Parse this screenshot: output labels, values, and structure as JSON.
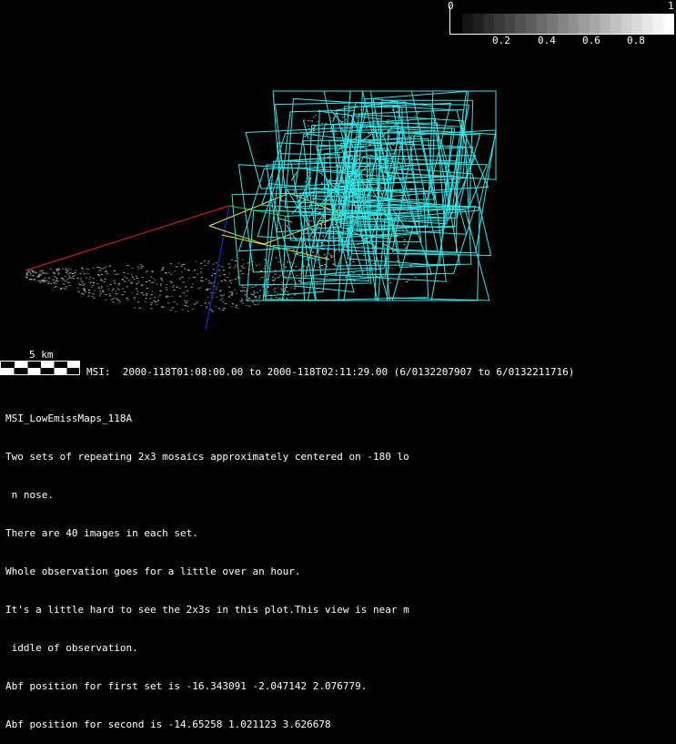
{
  "colorbar": {
    "min_label": "0",
    "max_label": "1",
    "ticks": [
      "0.2",
      "0.4",
      "0.6",
      "0.8"
    ]
  },
  "scale": {
    "label": "5 km"
  },
  "msi_line": "MSI:  2000-118T01:08:00.00 to 2000-118T02:11:29.00 (6/0132207907 to 6/0132211716)",
  "notes": {
    "title": "MSI_LowEmissMaps_118A",
    "lines": [
      "Two sets of repeating 2x3 mosaics approximately centered on -180 lo",
      " n nose.",
      "There are 40 images in each set.",
      "Whole observation goes for a little over an hour.",
      "It's a little hard to see the 2x3s in this plot.This view is near m",
      " iddle of observation.",
      "Abf position for first set is -16.343091 -2.047142 2.076779.",
      "Abf position for second is -14.65258 1.021123 3.626678"
    ]
  },
  "colors": {
    "background": "#000000",
    "footprints": "#33e6e6",
    "axis_x": "#e02020",
    "axis_y": "#20c020",
    "axis_z": "#2030e0",
    "boresight": "#e6e63a",
    "asteroid": "#9a9a9a"
  }
}
